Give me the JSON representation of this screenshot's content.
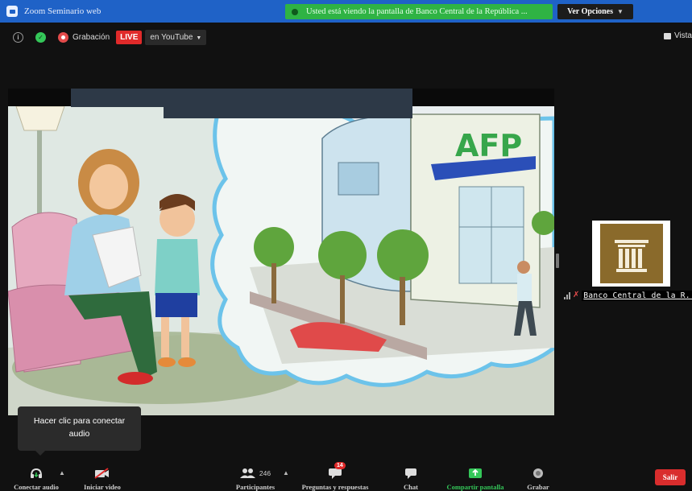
{
  "window": {
    "title": "Zoom Seminario web"
  },
  "share_banner": {
    "text": "Usted está viendo la pantalla de Banco Central de la República ..."
  },
  "view_options": {
    "label": "Ver Opciones"
  },
  "status": {
    "recording_label": "Grabación",
    "live_label": "LIVE",
    "stream_label": "en YouTube"
  },
  "view_button": {
    "label": "Vista"
  },
  "participant": {
    "name": "Banco Central de la R..."
  },
  "tooltip": {
    "text_line1": "Hacer clic para conectar",
    "text_line2": "audio"
  },
  "illustration": {
    "building_sign": "AFP"
  },
  "toolbar": {
    "audio_label": "Conectar audio",
    "video_label": "Iniciar video",
    "participants_label": "Participantes",
    "participants_count": "246",
    "qa_label": "Preguntas y respuestas",
    "qa_badge": "14",
    "chat_label": "Chat",
    "share_label": "Compartir pantalla",
    "record_label": "Grabar",
    "leave_label": "Salir"
  },
  "colors": {
    "titlebar": "#1f62c7",
    "banner": "#2fb344",
    "live": "#e02a2a",
    "share_green": "#34c759",
    "leave": "#d92d2d"
  }
}
